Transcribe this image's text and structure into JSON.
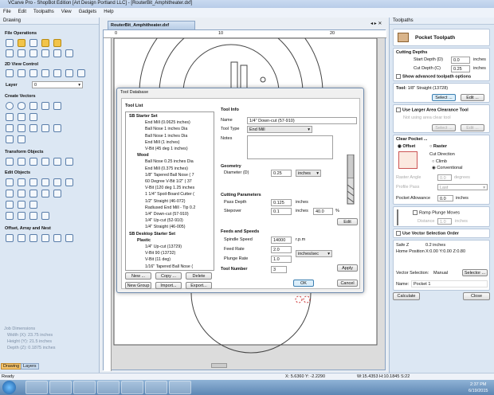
{
  "window": {
    "title": "VCarve Pro - ShopBot Edition [Art Design Portland LLC] - [RouterBit_Amphitheater.dxf]"
  },
  "menu": [
    "File",
    "Edit",
    "Toolpaths",
    "View",
    "Gadgets",
    "Help"
  ],
  "left_panel": {
    "title": "Drawing",
    "sections": [
      "File Operations",
      "2D View Control",
      "Create Vectors",
      "Transform Objects",
      "Edit Objects",
      "Offset, Array and Nest"
    ],
    "layer_label": "Layer",
    "layer_value": "0",
    "job_dimensions": {
      "title": "Job Dimensions",
      "width": "Width  (X): 23.75 inches",
      "height": "Height (Y): 21.5 inches",
      "depth": "Depth  (Z): 0.1875 inches"
    },
    "tabs": [
      "Drawing",
      "Layers"
    ]
  },
  "document": {
    "tab": "RouterBit_Amphitheater.dxf",
    "ruler_labels": [
      "0",
      "10",
      "20"
    ]
  },
  "dialog": {
    "title": "Tool Database",
    "tool_list_label": "Tool List",
    "tree": [
      {
        "level": 0,
        "text": "SB Starter Set",
        "bold": true
      },
      {
        "level": 2,
        "text": "End Mill (0.0625 inches)"
      },
      {
        "level": 2,
        "text": "Ball Nose 1 inches Dia"
      },
      {
        "level": 2,
        "text": "Ball Nose 1 inches Dia"
      },
      {
        "level": 2,
        "text": "End Mill (1 inches)"
      },
      {
        "level": 2,
        "text": "V-Bit (45 deg 1 inches)"
      },
      {
        "level": 1,
        "text": "Wood",
        "bold": true
      },
      {
        "level": 2,
        "text": "Ball Nose 0.25 inches Dia"
      },
      {
        "level": 2,
        "text": "End Mill (0.375 inches)"
      },
      {
        "level": 2,
        "text": "1/8\" Tapered Ball Nose ( 7"
      },
      {
        "level": 2,
        "text": "60 Degree V-Bit 1/2\" ( 37"
      },
      {
        "level": 2,
        "text": "V-Bit (120 deg 1.25 inches"
      },
      {
        "level": 2,
        "text": "1 1/4\" Spoil-Board Cutter ("
      },
      {
        "level": 2,
        "text": "1/2\" Straight  (46-072)"
      },
      {
        "level": 2,
        "text": "Radiused End Mill - Tip 0.2"
      },
      {
        "level": 2,
        "text": "1/4\"  Down-cut (57-910)"
      },
      {
        "level": 2,
        "text": "1/4\" Up-cut (52-910)"
      },
      {
        "level": 2,
        "text": "1/4\" Straight  (46-005)"
      },
      {
        "level": 0,
        "text": "SB Desktop Starter Set",
        "bold": true
      },
      {
        "level": 1,
        "text": "Plastic",
        "bold": true
      },
      {
        "level": 2,
        "text": "1/4\" Up-cut (13729)"
      },
      {
        "level": 2,
        "text": "V-Bit 90 (13732)"
      },
      {
        "level": 2,
        "text": "V-Bit (11 deg)"
      },
      {
        "level": 2,
        "text": "1/16\" Tapered Ball Nose ("
      }
    ],
    "list_buttons": [
      "New ...",
      "Copy ...",
      "Delete",
      "New Group",
      "Import...",
      "Export..."
    ],
    "tool_info": {
      "title": "Tool Info",
      "name_label": "Name",
      "name": "1/4\"  Down-cut (57-910)",
      "type_label": "Tool Type",
      "type": "End Mill",
      "notes_label": "Notes"
    },
    "geometry": {
      "title": "Geometry",
      "diameter_label": "Diameter (D)",
      "diameter": "0.25",
      "units": "inches"
    },
    "cutting": {
      "title": "Cutting Parameters",
      "pass_depth_label": "Pass Depth",
      "pass_depth": "0.125",
      "pass_units": "inches",
      "stepover_label": "Stepover",
      "stepover": "0.1",
      "stepover_units": "inches",
      "stepover_pct": "40.0",
      "pct": "%",
      "edit": "Edit"
    },
    "feeds": {
      "title": "Feeds and Speeds",
      "spindle_label": "Spindle Speed",
      "spindle": "14000",
      "spindle_units": "r.p.m",
      "feed_label": "Feed Rate",
      "feed": "2.0",
      "plunge_label": "Plunge Rate",
      "plunge": "1.0",
      "rate_units": "inches/sec"
    },
    "tool_number_label": "Tool Number",
    "tool_number": "3",
    "apply": "Apply",
    "ok": "OK",
    "cancel": "Cancel"
  },
  "right_panel": {
    "title": "Toolpaths",
    "heading": "Pocket Toolpath",
    "cutting_depths": {
      "title": "Cutting Depths",
      "start_label": "Start Depth (D)",
      "start": "0.0",
      "cut_label": "Cut Depth (C)",
      "cut": "0.25",
      "units": "inches",
      "advanced": "Show advanced toolpath options"
    },
    "tool": {
      "label": "Tool:",
      "value": "1/8\" Straight (13728)",
      "select": "Select ...",
      "edit": "Edit ..."
    },
    "larger": {
      "label": "Use Larger Area Clearance Tool",
      "placeholder": "Not using area clear tool",
      "select": "Select ...",
      "edit": "Edit ..."
    },
    "clear": {
      "title": "Clear Pocket ...",
      "offset": "Offset",
      "raster": "Raster",
      "cut_direction": "Cut Direction",
      "climb": "Climb",
      "conventional": "Conventional",
      "raster_angle_label": "Raster Angle",
      "raster_angle": "0.0",
      "degrees": "degrees",
      "profile_pass_label": "Profile Pass",
      "profile_pass": "Last"
    },
    "allowance": {
      "label": "Pocket Allowance",
      "value": "0.0",
      "units": "inches"
    },
    "ramp": {
      "label": "Ramp Plunge Moves",
      "distance_label": "Distance",
      "distance": "1.0",
      "units": "inches"
    },
    "vector_order": "Use Vector Selection Order",
    "safe_z_label": "Safe Z",
    "safe_z": "0.2 inches",
    "home_label": "Home Position",
    "home": "X:0.00 Y:0.00 Z:0.80",
    "vector_sel_label": "Vector Selection:",
    "vector_sel": "Manual",
    "selector": "Selector ...",
    "name_label": "Name:",
    "name": "Pocket 1",
    "calculate": "Calculate",
    "close": "Close"
  },
  "status": {
    "text": "Ready",
    "coords": "X: 5.6360 Y: -2.2290",
    "dims": "W:15.4353  H:10.1845  S:22"
  },
  "taskbar": {
    "time": "2:37 PM",
    "date": "6/19/2015"
  },
  "colors": {
    "accent": "#3a6ea5",
    "panel": "#dce7f3",
    "tab_active": "#f5c36a"
  }
}
